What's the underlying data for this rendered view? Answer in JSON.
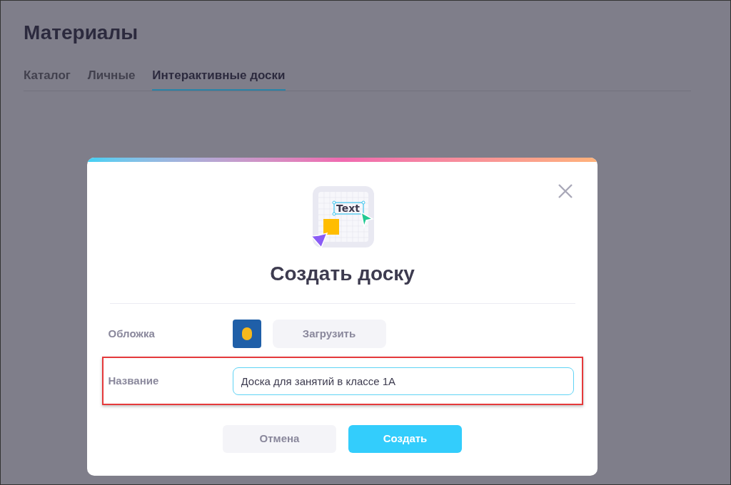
{
  "page": {
    "title": "Материалы"
  },
  "tabs": [
    {
      "label": "Каталог",
      "selected": false
    },
    {
      "label": "Личные",
      "selected": false
    },
    {
      "label": "Интерактивные доски",
      "selected": true
    }
  ],
  "dialog": {
    "illustration_text": "Text",
    "title": "Создать доску",
    "fields": [
      {
        "kind": "cover",
        "label": "Обложка",
        "button": "Загрузить",
        "highlighted": false
      },
      {
        "kind": "text",
        "label": "Название",
        "value": "Доска для занятий в классе 1А",
        "highlighted": true
      }
    ],
    "buttons": [
      {
        "label": "Отмена",
        "primary": false
      },
      {
        "label": "Создать",
        "primary": true
      }
    ]
  }
}
